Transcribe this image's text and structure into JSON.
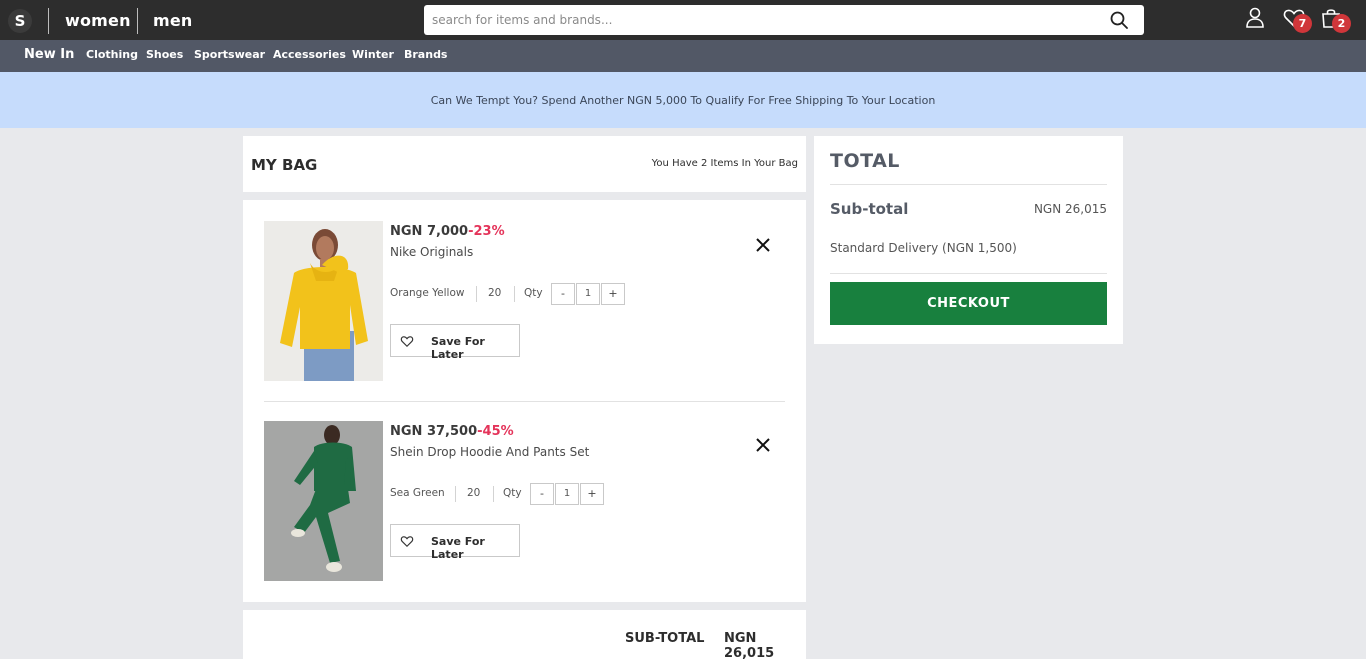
{
  "header": {
    "logo": "S",
    "genders": [
      "women",
      "men"
    ],
    "search_placeholder": "search for items and brands...",
    "wishlist_count": "7",
    "bag_count": "2",
    "icons": [
      "account-icon",
      "heart-icon",
      "bag-icon",
      "search-icon"
    ]
  },
  "nav": {
    "items": [
      "New In",
      "Clothing",
      "Shoes",
      "Sportswear",
      "Accessories",
      "Winter",
      "Brands"
    ]
  },
  "promo": {
    "text": "Can We Tempt You? Spend Another NGN 5,000 To Qualify For Free Shipping To Your Location"
  },
  "bag": {
    "title": "MY BAG",
    "count_text": "You Have 2 Items In Your Bag",
    "items": [
      {
        "price": "NGN 7,000",
        "discount": "-23%",
        "name": "Nike Originals",
        "color": "Orange Yellow",
        "size": "20",
        "qty_label": "Qty",
        "qty": "1",
        "minus": "-",
        "plus": "+",
        "save_label": "Save For Later",
        "image_color": "#f2c21b"
      },
      {
        "price": "NGN 37,500",
        "discount": "-45%",
        "name": "Shein Drop Hoodie And Pants Set",
        "color": "Sea Green",
        "size": "20",
        "qty_label": "Qty",
        "qty": "1",
        "minus": "-",
        "plus": "+",
        "save_label": "Save For Later",
        "image_color": "#1f6b43"
      }
    ],
    "subtotal_label": "SUB-TOTAL",
    "subtotal_value": "NGN 26,015"
  },
  "total": {
    "title": "TOTAL",
    "subtotal_label": "Sub-total",
    "subtotal_value": "NGN 26,015",
    "delivery": "Standard Delivery (NGN 1,500)",
    "checkout_label": "CHECKOUT"
  },
  "colors": {
    "topbar": "#2d2d2d",
    "navbar": "#525866",
    "promo": "#c6dcfc",
    "discount": "#e4345a",
    "checkout": "#18803e",
    "badge": "#d0363a"
  }
}
